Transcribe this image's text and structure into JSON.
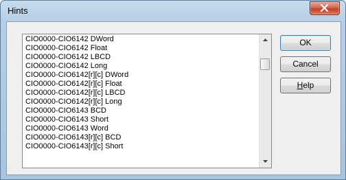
{
  "window": {
    "title": "Hints"
  },
  "list": {
    "items": [
      "CIO0000-CIO6142 DWord",
      "CIO0000-CIO6142 Float",
      "CIO0000-CIO6142 LBCD",
      "CIO0000-CIO6142 Long",
      "CIO0000-CIO6142[r][c] DWord",
      "CIO0000-CIO6142[r][c] Float",
      "CIO0000-CIO6142[r][c] LBCD",
      "CIO0000-CIO6142[r][c] Long",
      "CIO0000-CIO6143 BCD",
      "CIO0000-CIO6143 Short",
      "CIO0000-CIO6143 Word",
      "CIO0000-CIO6143[r][c] BCD",
      "CIO0000-CIO6143[r][c] Short"
    ]
  },
  "buttons": {
    "ok": "OK",
    "cancel": "Cancel",
    "help_underlined": "H",
    "help_rest": "elp"
  },
  "icons": {
    "close": "close-icon",
    "scroll_up": "arrow-up-icon",
    "scroll_down": "arrow-down-icon"
  }
}
